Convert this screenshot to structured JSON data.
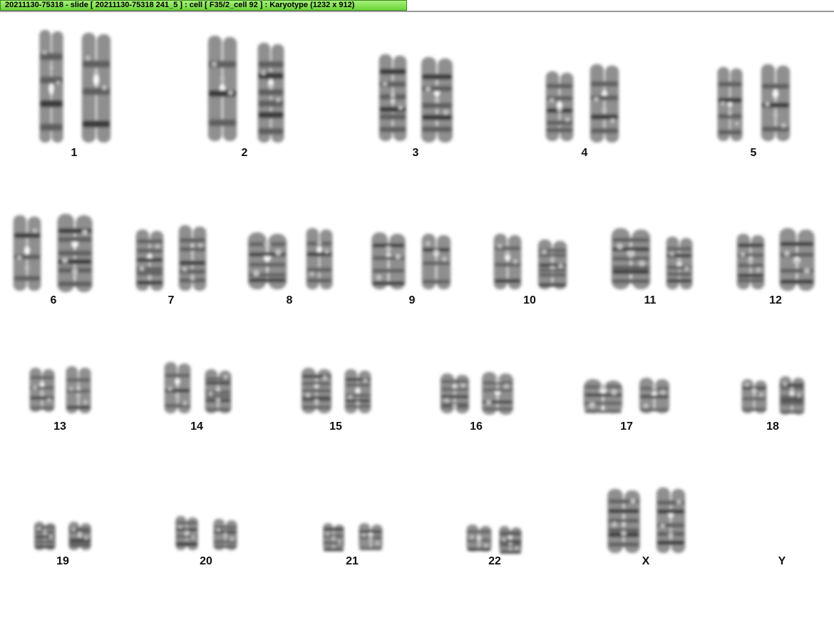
{
  "window": {
    "title": "20211130-75318 - slide [ 20211130-75318 241_5 ] : cell [ F35/2_cell 92 ] : Karyotype  (1232 x 912)"
  },
  "karyotype": {
    "pairs": [
      {
        "label": "1",
        "count": 2
      },
      {
        "label": "2",
        "count": 2
      },
      {
        "label": "3",
        "count": 2
      },
      {
        "label": "4",
        "count": 2
      },
      {
        "label": "5",
        "count": 2
      },
      {
        "label": "6",
        "count": 2
      },
      {
        "label": "7",
        "count": 2
      },
      {
        "label": "8",
        "count": 2
      },
      {
        "label": "9",
        "count": 2
      },
      {
        "label": "10",
        "count": 2
      },
      {
        "label": "11",
        "count": 2
      },
      {
        "label": "12",
        "count": 2
      },
      {
        "label": "13",
        "count": 2
      },
      {
        "label": "14",
        "count": 2
      },
      {
        "label": "15",
        "count": 2
      },
      {
        "label": "16",
        "count": 2
      },
      {
        "label": "17",
        "count": 2
      },
      {
        "label": "18",
        "count": 2
      },
      {
        "label": "19",
        "count": 2
      },
      {
        "label": "20",
        "count": 2
      },
      {
        "label": "21",
        "count": 2
      },
      {
        "label": "22",
        "count": 2
      },
      {
        "label": "X",
        "count": 2
      },
      {
        "label": "Y",
        "count": 0
      }
    ]
  }
}
